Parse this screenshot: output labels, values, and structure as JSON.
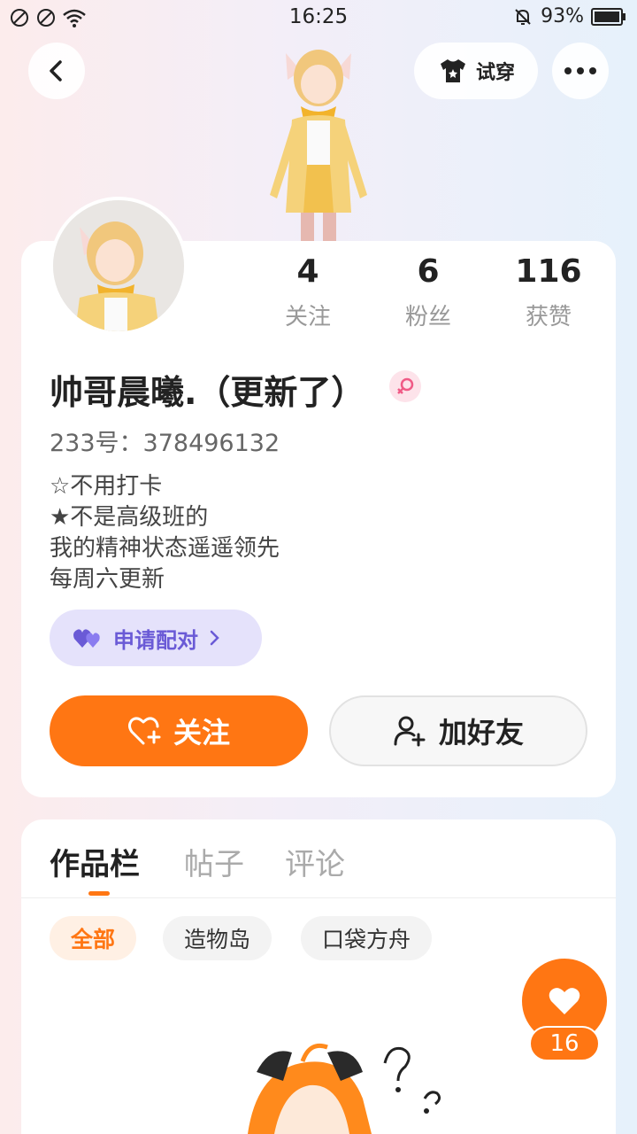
{
  "status_bar": {
    "time": "16:25",
    "battery": "93%"
  },
  "header": {
    "tryon_label": "试穿"
  },
  "profile": {
    "stats": [
      {
        "value": "4",
        "label": "关注"
      },
      {
        "value": "6",
        "label": "粉丝"
      },
      {
        "value": "116",
        "label": "获赞"
      }
    ],
    "username": "帅哥晨曦.（更新了）",
    "uid": "233号：378496132",
    "bio": [
      "☆不用打卡",
      "★不是高级班的",
      "我的精神状态遥遥领先",
      "每周六更新"
    ],
    "match_label": "申请配对",
    "follow_label": "关注",
    "add_friend_label": "加好友"
  },
  "tabs": [
    {
      "label": "作品栏",
      "active": true
    },
    {
      "label": "帖子",
      "active": false
    },
    {
      "label": "评论",
      "active": false
    }
  ],
  "filters": [
    {
      "label": "全部",
      "active": true
    },
    {
      "label": "造物岛",
      "active": false
    },
    {
      "label": "口袋方舟",
      "active": false
    }
  ],
  "like_count": "16",
  "colors": {
    "accent": "#ff7613",
    "match": "#6a5ad6",
    "gender": "#f05a86"
  },
  "icons": [
    "back-icon",
    "shirt-icon",
    "more-icon",
    "heart-icon",
    "add-user-icon",
    "female-icon",
    "chevron-right-icon",
    "bell-muted-icon",
    "wifi-icon",
    "battery-icon"
  ]
}
